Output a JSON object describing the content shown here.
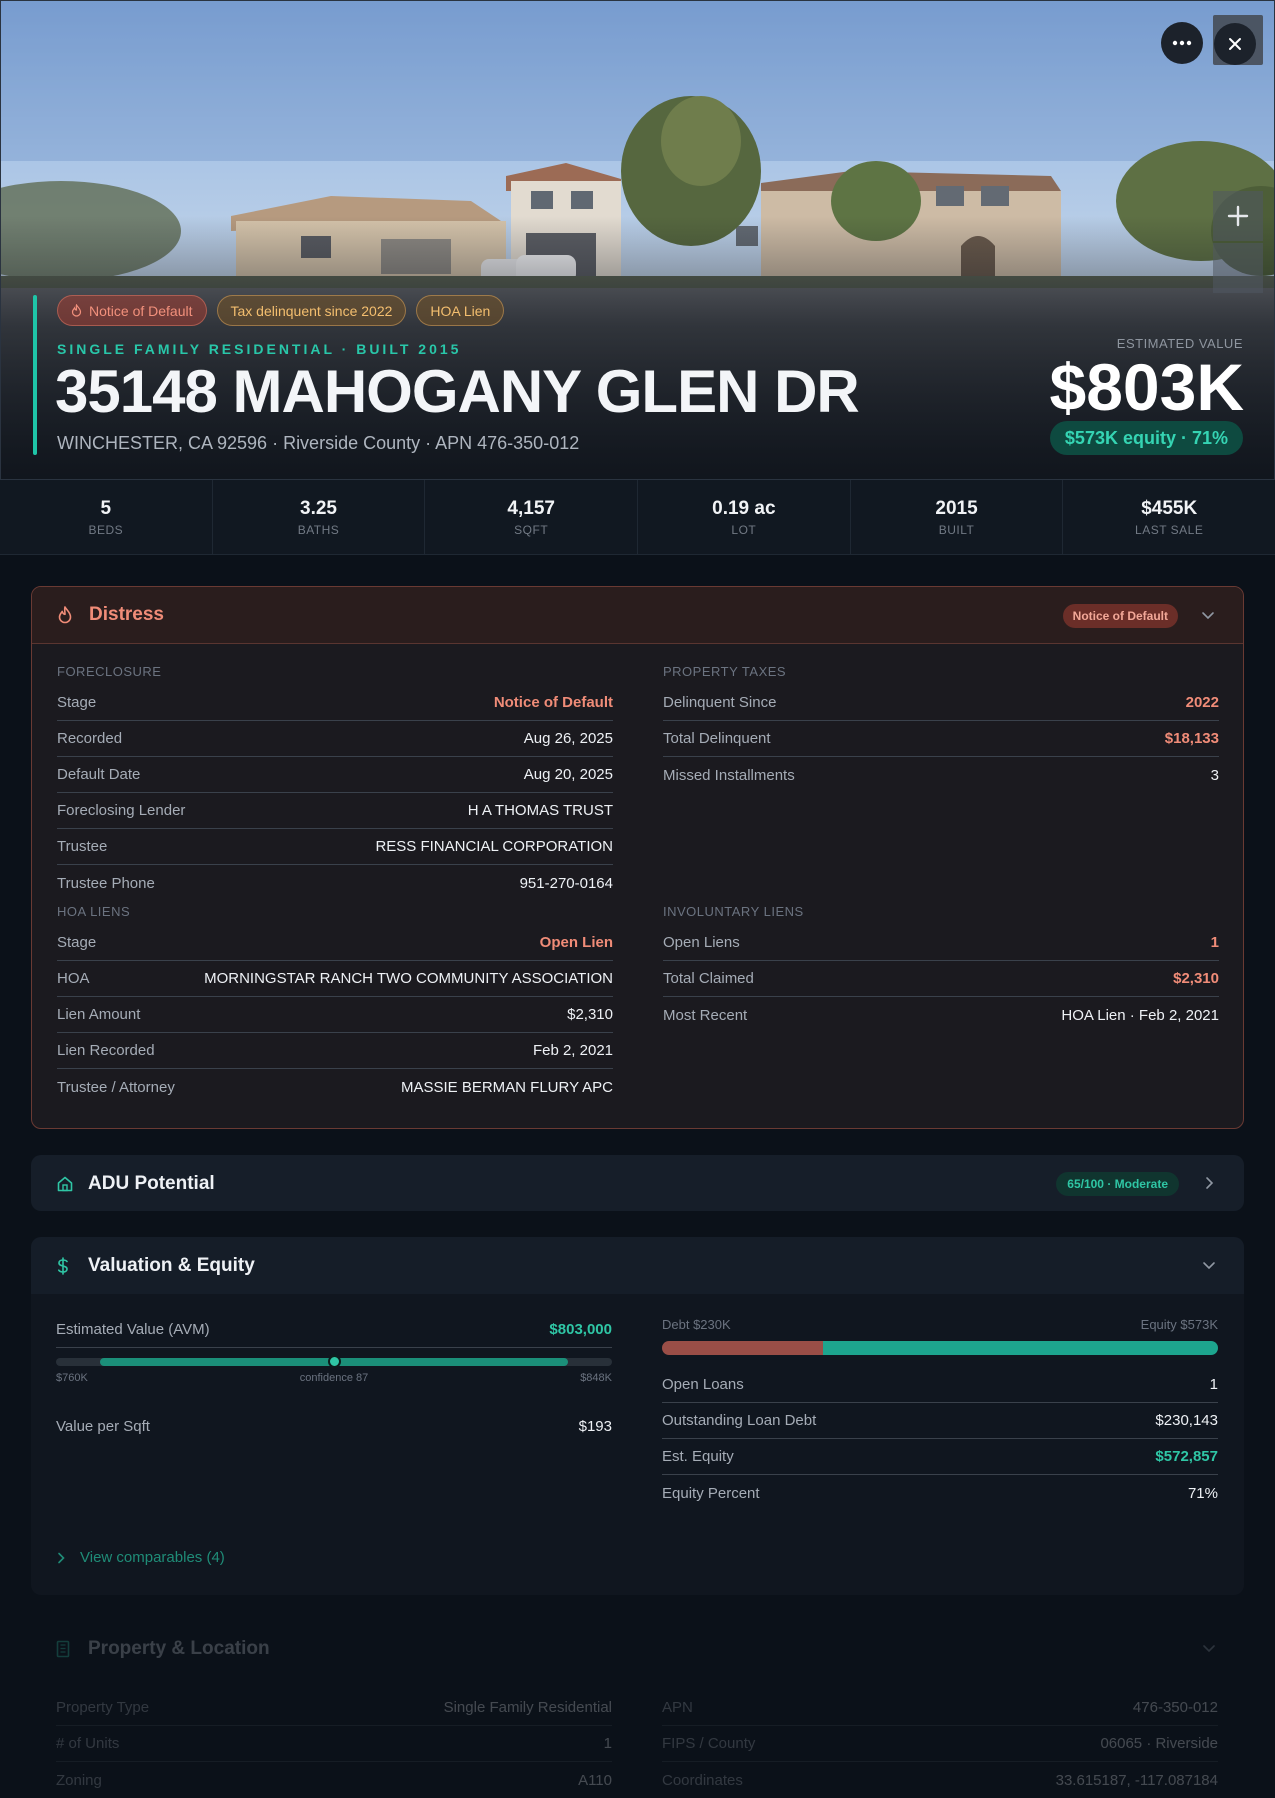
{
  "hero": {
    "badges": [
      {
        "label": "Notice of Default",
        "tone": "red",
        "icon": "flame-icon"
      },
      {
        "label": "Tax delinquent since 2022",
        "tone": "amber"
      },
      {
        "label": "HOA Lien",
        "tone": "amber"
      }
    ],
    "subtype": "SINGLE FAMILY RESIDENTIAL · BUILT 2015",
    "address": "35148 MAHOGANY GLEN DR",
    "address_sub": "WINCHESTER, CA 92596 · Riverside County · APN 476-350-012",
    "est_label": "ESTIMATED VALUE",
    "est_value": "$803K",
    "equity_pill": "$573K equity · 71%",
    "controls": [
      "more-icon",
      "close-icon",
      "plus-icon"
    ]
  },
  "stats": [
    {
      "value": "5",
      "label": "BEDS"
    },
    {
      "value": "3.25",
      "label": "BATHS"
    },
    {
      "value": "4,157",
      "label": "SQFT"
    },
    {
      "value": "0.19 ac",
      "label": "LOT"
    },
    {
      "value": "2015",
      "label": "BUILT"
    },
    {
      "value": "$455K",
      "label": "LAST SALE"
    }
  ],
  "distress": {
    "title": "Distress",
    "pill": "Notice of Default",
    "foreclosure": {
      "label": "FORECLOSURE",
      "rows": [
        {
          "k": "Stage",
          "v": "Notice of Default"
        },
        {
          "k": "Recorded",
          "v": "Aug 26, 2025"
        },
        {
          "k": "Default Date",
          "v": "Aug 20, 2025"
        },
        {
          "k": "Foreclosing Lender",
          "v": "H A THOMAS TRUST"
        },
        {
          "k": "Trustee",
          "v": "RESS FINANCIAL CORPORATION"
        },
        {
          "k": "Trustee Phone",
          "v": "951-270-0164"
        }
      ]
    },
    "taxes": {
      "label": "PROPERTY TAXES",
      "rows": [
        {
          "k": "Delinquent Since",
          "v": "2022"
        },
        {
          "k": "Total Delinquent",
          "v": "$18,133"
        },
        {
          "k": "Missed Installments",
          "v": "3"
        }
      ]
    },
    "hoa": {
      "label": "HOA LIENS",
      "rows": [
        {
          "k": "Stage",
          "v": "Open Lien"
        },
        {
          "k": "HOA",
          "v": "MORNINGSTAR RANCH TWO COMMUNITY ASSOCIATION"
        },
        {
          "k": "Lien Amount",
          "v": "$2,310"
        },
        {
          "k": "Lien Recorded",
          "v": "Feb 2, 2021"
        },
        {
          "k": "Trustee / Attorney",
          "v": "MASSIE BERMAN FLURY APC"
        }
      ]
    },
    "involuntary": {
      "label": "INVOLUNTARY LIENS",
      "rows": [
        {
          "k": "Open Liens",
          "v": "1"
        },
        {
          "k": "Total Claimed",
          "v": "$2,310"
        },
        {
          "k": "Most Recent",
          "v": "HOA Lien · Feb 2, 2021"
        }
      ]
    }
  },
  "adu": {
    "title": "ADU Potential",
    "pill": "65/100 · Moderate"
  },
  "valuation": {
    "title": "Valuation & Equity",
    "avm_label": "Estimated Value (AVM)",
    "avm_value": "$803,000",
    "range_low": "$760K",
    "range_high": "$848K",
    "confidence": "confidence 87",
    "value_per_sqft_label": "Value per Sqft",
    "value_per_sqft": "$193",
    "debt_label": "Debt $230K",
    "equity_label": "Equity $573K",
    "equity_fraction": 0.71,
    "rows": [
      {
        "k": "Open Loans",
        "v": "1"
      },
      {
        "k": "Outstanding Loan Debt",
        "v": "$230,143"
      },
      {
        "k": "Est. Equity",
        "v": "$572,857"
      },
      {
        "k": "Equity Percent",
        "v": "71%"
      }
    ],
    "comparables_link": "View comparables (4)"
  },
  "property": {
    "title": "Property & Location",
    "left_rows": [
      {
        "k": "Property Type",
        "v": "Single Family Residential"
      },
      {
        "k": "# of Units",
        "v": "1"
      },
      {
        "k": "Zoning",
        "v": "A110"
      }
    ],
    "right_rows": [
      {
        "k": "APN",
        "v": "476-350-012"
      },
      {
        "k": "FIPS / County",
        "v": "06065 · Riverside"
      },
      {
        "k": "Coordinates",
        "v": "33.615187, -117.087184"
      }
    ]
  },
  "colors": {
    "accent": "#1fc5a8",
    "danger": "#f08c78",
    "amber": "#f3be6f",
    "background": "#0b1119"
  }
}
